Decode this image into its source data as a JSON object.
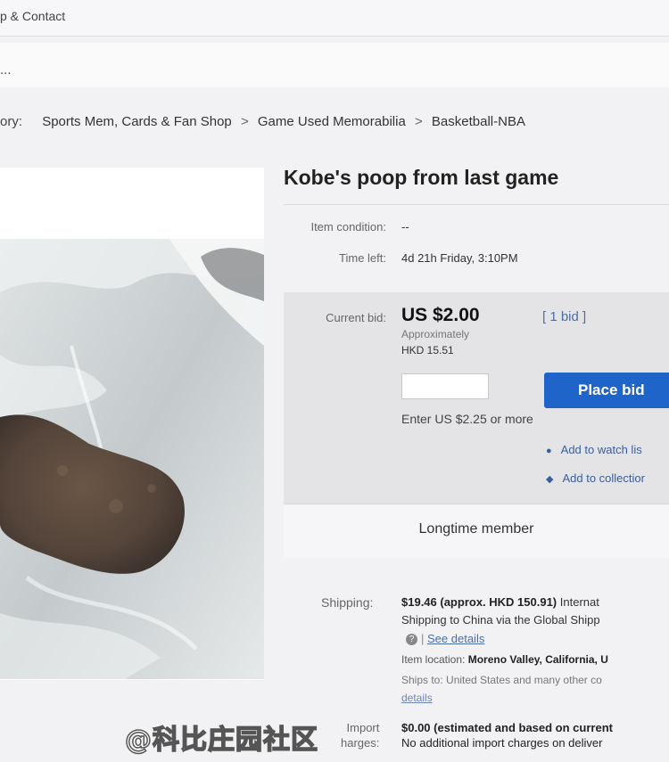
{
  "topbar": {
    "link": "p & Contact"
  },
  "subbar": {
    "text": "..."
  },
  "breadcrumb": {
    "prefix": "ory:",
    "items": [
      "Sports Mem, Cards & Fan Shop",
      "Game Used Memorabilia",
      "Basketball-NBA"
    ],
    "separator": ">"
  },
  "listing": {
    "title": "Kobe's poop from last game",
    "condition_label": "Item condition:",
    "condition_value": "--",
    "time_left_label": "Time left:",
    "time_left_value": "4d 21h Friday, 3:10PM"
  },
  "bid": {
    "current_label": "Current bid:",
    "price": "US $2.00",
    "approx_label": "Approximately",
    "approx_value": "HKD 15.51",
    "bid_count": "[ 1 bid ]",
    "place_bid_label": "Place bid",
    "enter_note": "Enter US $2.25 or more",
    "watch_label": "Add to watch lis",
    "collection_label": "Add to collectior",
    "input_value": ""
  },
  "member": {
    "text": "Longtime member"
  },
  "shipping": {
    "label": "Shipping:",
    "cost": "$19.46 (approx. HKD 150.91)",
    "intl": "Internat",
    "line2": "Shipping to China via the Global Shipp",
    "see_details": "See details",
    "location_label": "Item location:",
    "location_value": "Moreno Valley, California, U",
    "ships_to": "Ships to: United States and many other co",
    "details_link": "details"
  },
  "import": {
    "label_line1": "Import",
    "label_line2": "harges:",
    "value_line1": "$0.00 (estimated and based on current",
    "value_line2": "No additional import charges on deliver"
  },
  "watermark": "@科比庄园社区",
  "colors": {
    "accent": "#1f64c8",
    "link": "#4a6fa8"
  }
}
